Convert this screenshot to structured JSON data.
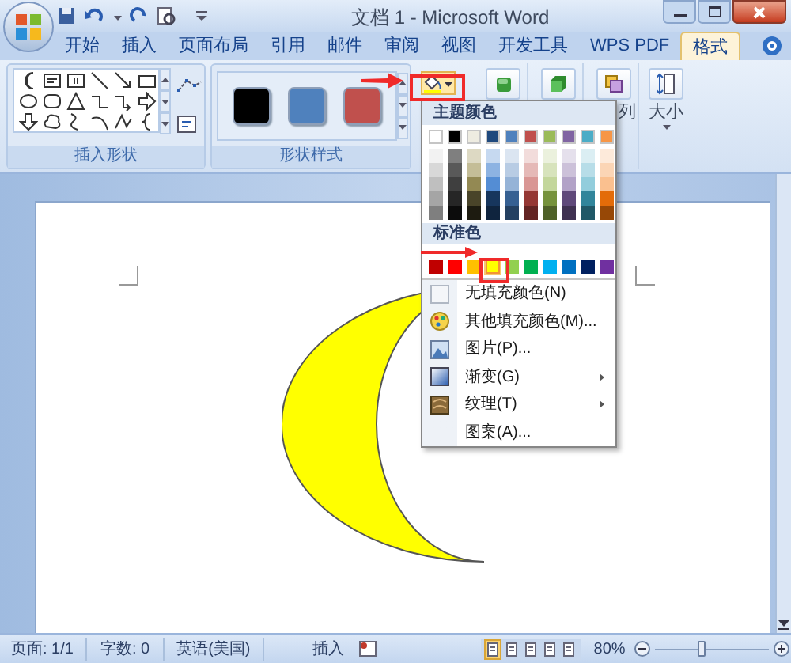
{
  "window": {
    "title": "文档 1 - Microsoft Word"
  },
  "tabs": [
    {
      "label": "开始",
      "selected": false
    },
    {
      "label": "插入",
      "selected": false
    },
    {
      "label": "页面布局",
      "selected": false
    },
    {
      "label": "引用",
      "selected": false
    },
    {
      "label": "邮件",
      "selected": false
    },
    {
      "label": "审阅",
      "selected": false
    },
    {
      "label": "视图",
      "selected": false
    },
    {
      "label": "开发工具",
      "selected": false
    },
    {
      "label": "WPS PDF",
      "selected": false
    },
    {
      "label": "格式",
      "selected": true
    }
  ],
  "ribbon": {
    "groups": [
      "插入形状",
      "形状样式"
    ],
    "shape_styles": [
      {
        "color": "#000000"
      },
      {
        "color": "#4f81bd"
      },
      {
        "color": "#c0504d"
      }
    ],
    "arrange_label": "列",
    "size_label": "大小"
  },
  "fill_menu": {
    "theme_header": "主题颜色",
    "theme_colors": [
      {
        "color": "#ffffff",
        "selected": false,
        "shades": [
          {
            "color": "#f2f2f2"
          },
          {
            "color": "#d8d8d8"
          },
          {
            "color": "#bfbfbf"
          },
          {
            "color": "#a5a5a5"
          },
          {
            "color": "#7f7f7f"
          }
        ]
      },
      {
        "color": "#000000",
        "selected": false,
        "shades": [
          {
            "color": "#7f7f7f"
          },
          {
            "color": "#595959"
          },
          {
            "color": "#3f3f3f"
          },
          {
            "color": "#262626"
          },
          {
            "color": "#0c0c0c"
          }
        ]
      },
      {
        "color": "#eeece1",
        "selected": false,
        "shades": [
          {
            "color": "#ddd9c3"
          },
          {
            "color": "#c4bd97"
          },
          {
            "color": "#938953"
          },
          {
            "color": "#494429"
          },
          {
            "color": "#1d1b10"
          }
        ]
      },
      {
        "color": "#1f497d",
        "selected": false,
        "shades": [
          {
            "color": "#c6d9f0"
          },
          {
            "color": "#8db3e2"
          },
          {
            "color": "#548dd4"
          },
          {
            "color": "#17365d"
          },
          {
            "color": "#0f243e"
          }
        ]
      },
      {
        "color": "#4f81bd",
        "selected": false,
        "shades": [
          {
            "color": "#dbe5f1"
          },
          {
            "color": "#b8cce4"
          },
          {
            "color": "#95b3d7"
          },
          {
            "color": "#366092"
          },
          {
            "color": "#244061"
          }
        ]
      },
      {
        "color": "#c0504d",
        "selected": false,
        "shades": [
          {
            "color": "#f2dcdb"
          },
          {
            "color": "#e5b9b7"
          },
          {
            "color": "#d99694"
          },
          {
            "color": "#953734"
          },
          {
            "color": "#632423"
          }
        ]
      },
      {
        "color": "#9bbb59",
        "selected": false,
        "shades": [
          {
            "color": "#ebf1dd"
          },
          {
            "color": "#d7e3bc"
          },
          {
            "color": "#c3d69b"
          },
          {
            "color": "#76923c"
          },
          {
            "color": "#4f6128"
          }
        ]
      },
      {
        "color": "#8064a2",
        "selected": false,
        "shades": [
          {
            "color": "#e5e0ec"
          },
          {
            "color": "#ccc1d9"
          },
          {
            "color": "#b2a2c7"
          },
          {
            "color": "#5f497a"
          },
          {
            "color": "#3f3151"
          }
        ]
      },
      {
        "color": "#4bacc6",
        "selected": false,
        "shades": [
          {
            "color": "#dbeef3"
          },
          {
            "color": "#b7dde8"
          },
          {
            "color": "#92cddc"
          },
          {
            "color": "#31859b"
          },
          {
            "color": "#205867"
          }
        ]
      },
      {
        "color": "#f79646",
        "selected": false,
        "shades": [
          {
            "color": "#fdeada"
          },
          {
            "color": "#fbd5b5"
          },
          {
            "color": "#fac08f"
          },
          {
            "color": "#e36c09"
          },
          {
            "color": "#974806"
          }
        ]
      }
    ],
    "standard_header": "标准色",
    "standard_colors": [
      {
        "color": "#c00000",
        "selected": false
      },
      {
        "color": "#ff0000",
        "selected": false
      },
      {
        "color": "#ffc000",
        "selected": false
      },
      {
        "color": "#ffff00",
        "selected": true
      },
      {
        "color": "#92d050",
        "selected": false
      },
      {
        "color": "#00b050",
        "selected": false
      },
      {
        "color": "#00b0f0",
        "selected": false
      },
      {
        "color": "#0070c0",
        "selected": false
      },
      {
        "color": "#002060",
        "selected": false
      },
      {
        "color": "#7030a0",
        "selected": false
      }
    ],
    "items": [
      {
        "label": "无填充颜色(N)",
        "submenu": false
      },
      {
        "label": "其他填充颜色(M)...",
        "submenu": false
      },
      {
        "label": "图片(P)...",
        "submenu": false
      },
      {
        "label": "渐变(G)",
        "submenu": true
      },
      {
        "label": "纹理(T)",
        "submenu": true
      },
      {
        "label": "图案(A)...",
        "submenu": false
      }
    ]
  },
  "status_bar": {
    "page": "页面: 1/1",
    "words": "字数: 0",
    "language": "英语(美国)",
    "mode": "插入",
    "zoom": "80%",
    "zoom_slider": {
      "level": 0.4
    }
  }
}
